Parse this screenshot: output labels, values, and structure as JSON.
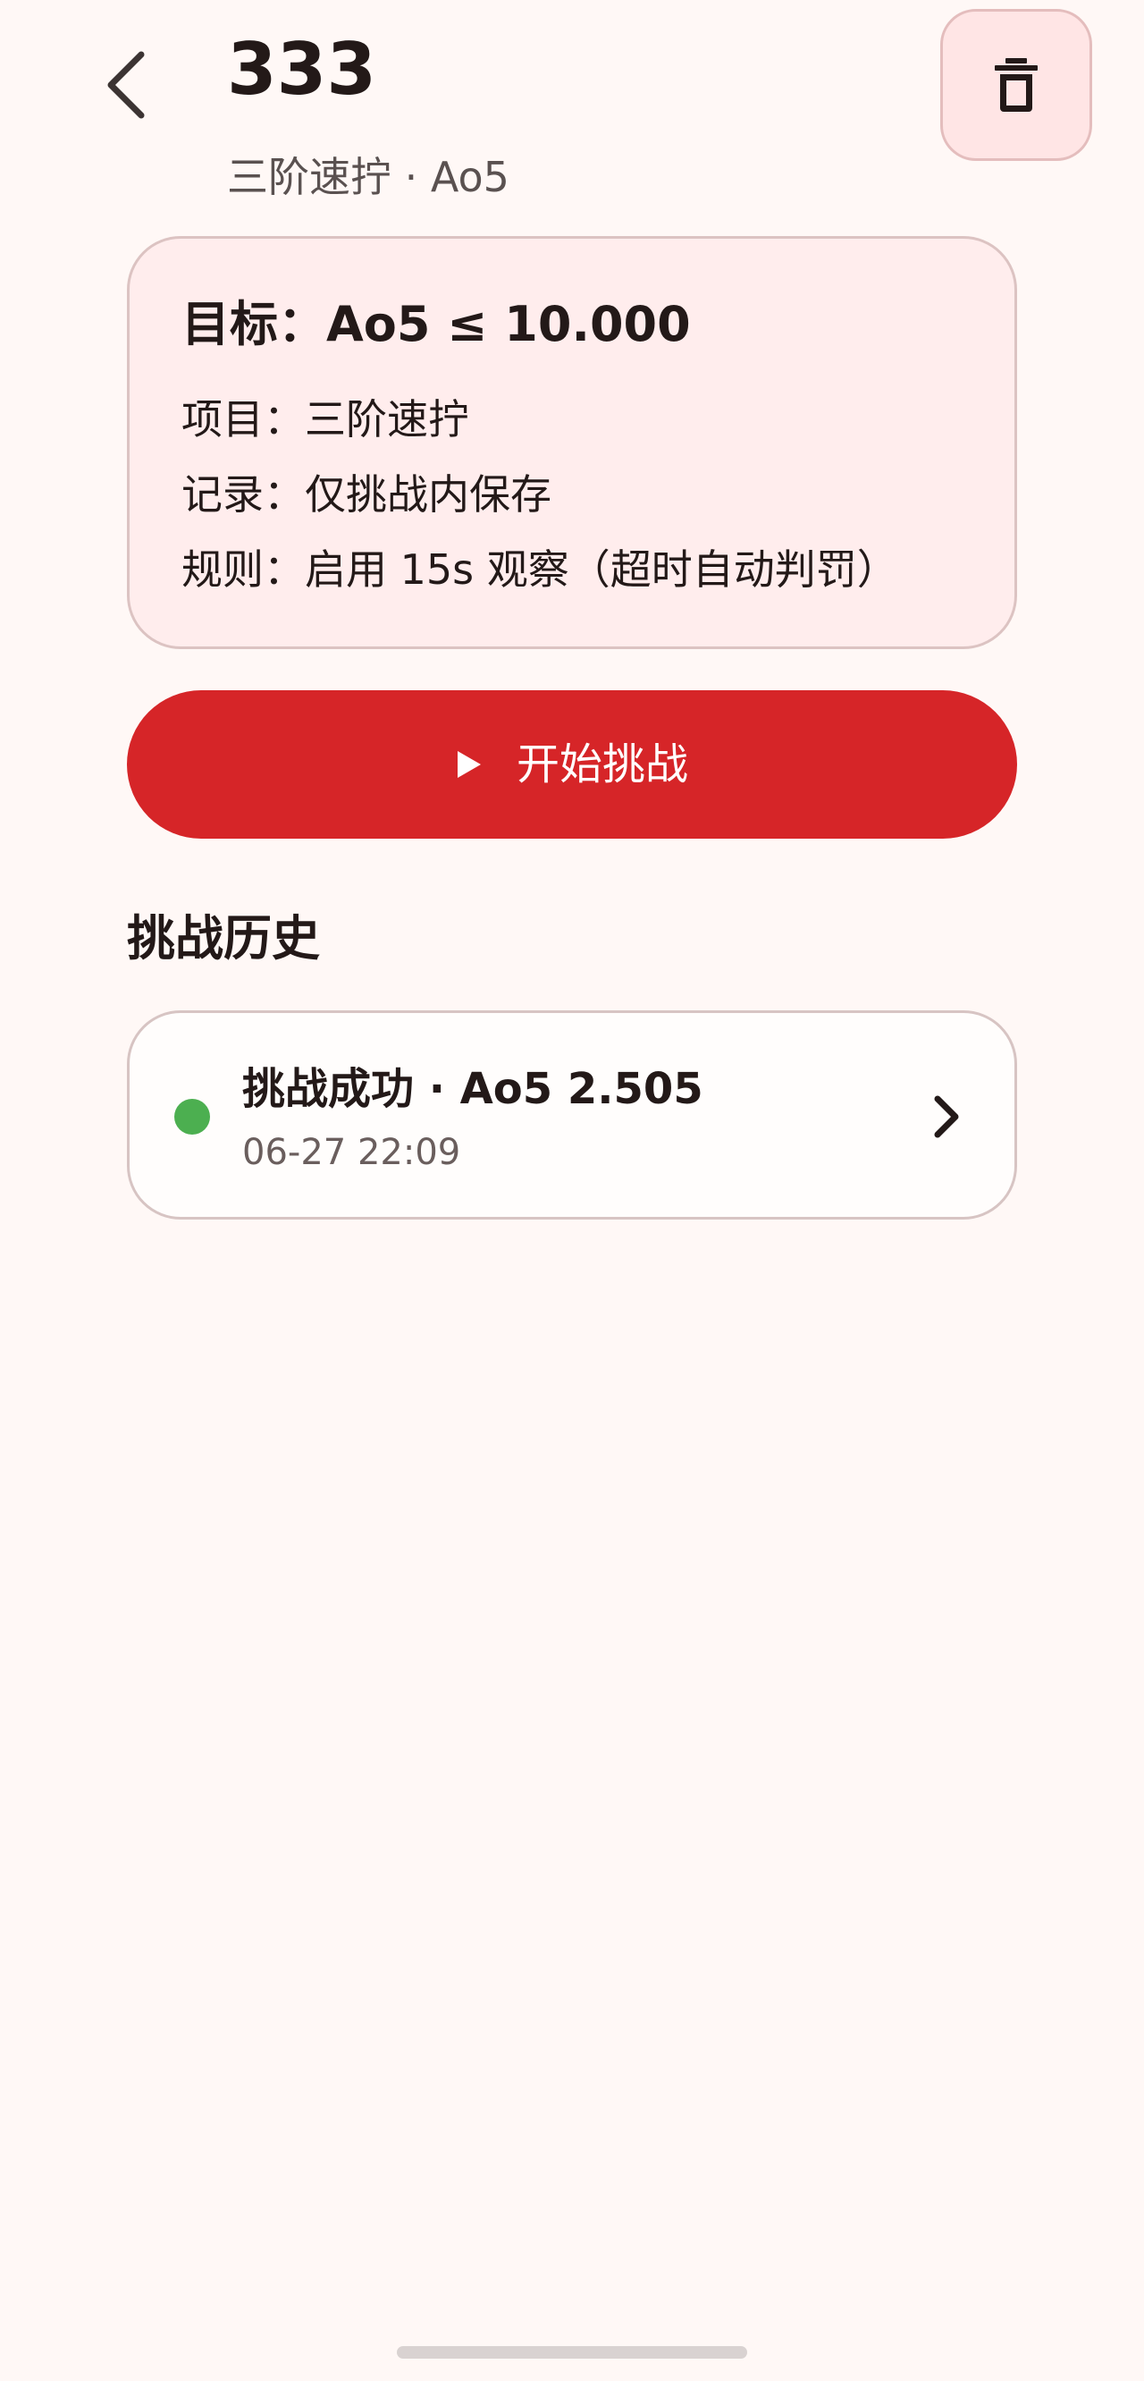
{
  "header": {
    "back_icon": "chevron-left-icon",
    "title": "333",
    "subtitle": "三阶速拧 · Ao5",
    "delete_icon": "trash-icon"
  },
  "goal_card": {
    "heading": "目标：Ao5 ≤ 10.000",
    "lines": [
      "项目：三阶速拧",
      "记录：仅挑战内保存",
      "规则：启用 15s 观察（超时自动判罚）"
    ]
  },
  "start_button": {
    "icon": "play-icon",
    "label": "开始挑战"
  },
  "history": {
    "section_title": "挑战历史",
    "items": [
      {
        "status": "success",
        "status_color": "#4caf50",
        "title": "挑战成功 · Ao5 2.505",
        "time": "06-27 22:09"
      }
    ]
  },
  "colors": {
    "accent": "#d62528",
    "background": "#fff8f6",
    "card_tint": "#ffeded"
  }
}
